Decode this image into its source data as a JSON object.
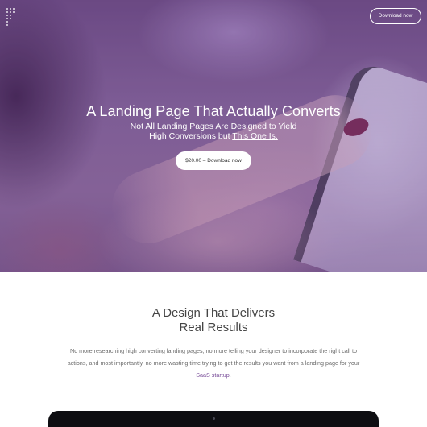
{
  "nav": {
    "download_label": "Download now"
  },
  "hero": {
    "title": "A Landing Page That Actually Converts",
    "subtitle_line1": "Not All Landing Pages Are Designed to Yield",
    "subtitle_line2_prefix": "High Conversions but ",
    "subtitle_line2_link": "This One Is.",
    "cta_label": "$20.00 – Download now"
  },
  "section": {
    "title_line1": "A Design That Delivers",
    "title_line2": "Real Results",
    "body_line1": "No more researching high converting landing pages, no more telling your designer to incorporate the right call to",
    "body_line2": "actions, and most importantly, no more wasting time trying to get the results you want from a landing page for your",
    "body_link": "SaaS startup",
    "body_end": "."
  },
  "colors": {
    "hero_overlay": "#6e4c86",
    "link": "#7a4f9a",
    "body_text": "#6a6a6a",
    "title_text": "#444444"
  },
  "icons": {
    "logo": "dotted-logo-icon",
    "camera": "camera-dot-icon"
  }
}
